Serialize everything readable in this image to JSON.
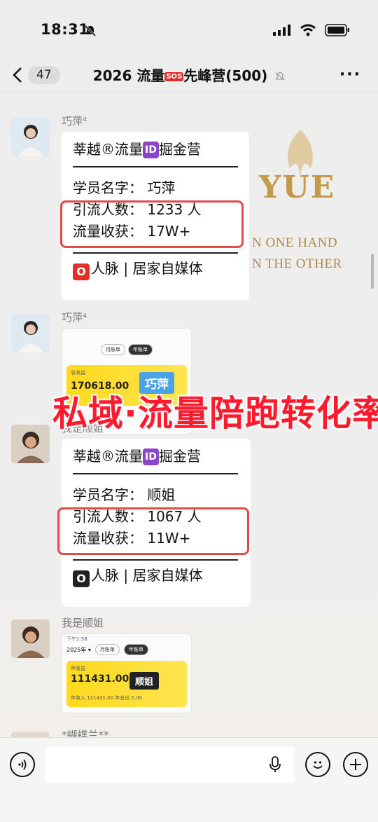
{
  "status_bar": {
    "time": "18:31"
  },
  "nav": {
    "back_count": "47",
    "title_prefix": "2026 流量",
    "title_sos": "SOS",
    "title_suffix": "先峰营(500)",
    "more": "···"
  },
  "background": {
    "brand_logo": "YUE",
    "line1": "N ONE HAND",
    "line2": "N THE OTHER"
  },
  "messages": [
    {
      "sender": "巧萍⁴",
      "header": "莘越®流量",
      "header_id": "ID",
      "header_tail": "掘金营",
      "student": "学员名字：  巧萍",
      "traffic": "引流人数：  1233 人",
      "harvest": "流量收获：  17W+",
      "footer": "人脉 | 居家自媒体",
      "footer_icon": "O"
    },
    {
      "sender": "巧萍⁴",
      "shot_tabs": [
        "月账单",
        "年账单"
      ],
      "card_label": "总收益",
      "card_value": "170618.00",
      "card_name": "巧萍"
    },
    {
      "sender": "我是顺姐",
      "header": "莘越®流量",
      "header_id": "ID",
      "header_tail": "掘金营",
      "student": "学员名字：  顺姐",
      "traffic": "引流人数：  1067 人",
      "harvest": "流量收获：  11W+",
      "footer": "人脉 | 居家自媒体",
      "footer_icon": "O"
    },
    {
      "sender": "我是顺姐",
      "shot_top": "下午2:58",
      "shot_year": "2025年 ▾",
      "shot_tabs": [
        "月账单",
        "年账单"
      ],
      "card_label": "年收益",
      "card_value": "111431.00",
      "card_name": "顺姐",
      "card_sub": "年收入 111431.00   年支出 0.00"
    },
    {
      "sender": "*蝴蝶兰**"
    }
  ],
  "overlay_banner": "私域·流量陪跑转化率",
  "colors": {
    "highlight": "#e14b4b",
    "banner": "#ff1a2e",
    "brand_gold": "#c39a4a"
  }
}
